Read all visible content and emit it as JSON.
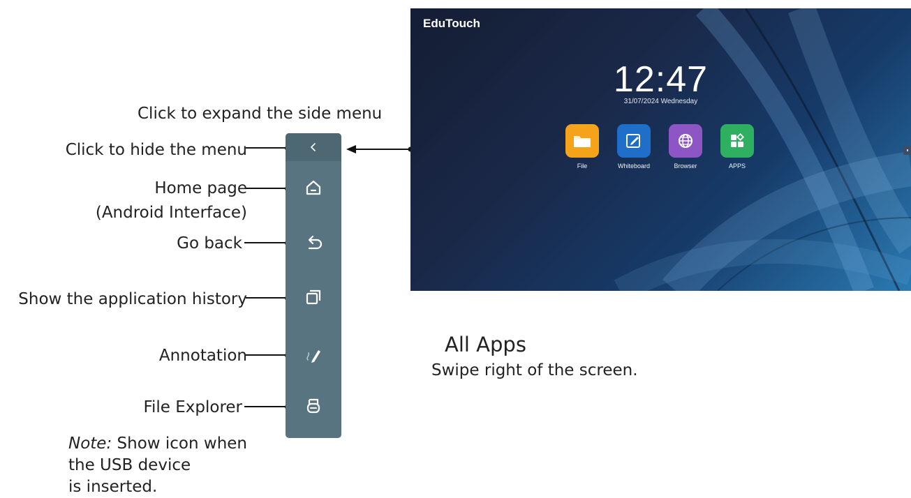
{
  "labels": {
    "expand_menu": "Click to expand the side menu",
    "hide_menu": "Click to hide the menu",
    "home_line1": "Home page",
    "home_line2": "(Android Interface)",
    "go_back": "Go back",
    "history": "Show the application history",
    "annotation": "Annotation",
    "file_explorer": "File Explorer"
  },
  "note": {
    "prefix": "Note:",
    "line1_rest": " Show icon when",
    "line2": "the USB device",
    "line3": "is inserted."
  },
  "all_apps": {
    "title": "All Apps",
    "subtitle": "Swipe right of the screen."
  },
  "side_menu": {
    "background": "#587480",
    "items": [
      {
        "icon": "chevron-left-icon"
      },
      {
        "icon": "home-icon"
      },
      {
        "icon": "back-arrow-icon"
      },
      {
        "icon": "app-history-icon"
      },
      {
        "icon": "annotation-pen-icon"
      },
      {
        "icon": "usb-drive-icon"
      }
    ]
  },
  "screen": {
    "brand": "EduTouch",
    "time": "12:47",
    "date": "31/07/2024  Wednesday",
    "apps": [
      {
        "label": "File",
        "icon": "folder-icon",
        "color": "#f5a31a"
      },
      {
        "label": "Whiteboard",
        "icon": "whiteboard-icon",
        "color": "#1f6fc8"
      },
      {
        "label": "Browser",
        "icon": "globe-icon",
        "color": "#8e56c4"
      },
      {
        "label": "APPS",
        "icon": "apps-grid-icon",
        "color": "#2fb061"
      }
    ]
  }
}
